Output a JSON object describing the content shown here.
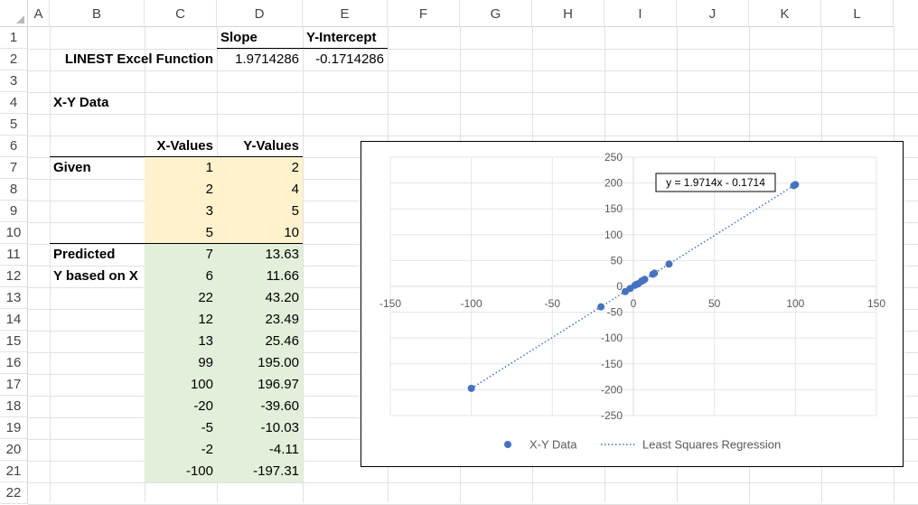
{
  "columns": [
    "A",
    "B",
    "C",
    "D",
    "E",
    "F",
    "G",
    "H",
    "I",
    "J",
    "K",
    "L"
  ],
  "rows": [
    "1",
    "2",
    "3",
    "4",
    "5",
    "6",
    "7",
    "8",
    "9",
    "10",
    "11",
    "12",
    "13",
    "14",
    "15",
    "16",
    "17",
    "18",
    "19",
    "20",
    "21",
    "22"
  ],
  "header": {
    "slope_label": "Slope",
    "intercept_label": "Y-Intercept"
  },
  "linest": {
    "label": "LINEST Excel Function",
    "slope": "1.9714286",
    "intercept": "-0.1714286"
  },
  "xy_title": "X-Y Data",
  "table": {
    "x_header": "X-Values",
    "y_header": "Y-Values",
    "given_label": "Given",
    "predicted_label": "Predicted",
    "predicted_sub": "Y based on X",
    "given": [
      {
        "x": "1",
        "y": "2"
      },
      {
        "x": "2",
        "y": "4"
      },
      {
        "x": "3",
        "y": "5"
      },
      {
        "x": "5",
        "y": "10"
      }
    ],
    "predicted": [
      {
        "x": "7",
        "y": "13.63"
      },
      {
        "x": "6",
        "y": "11.66"
      },
      {
        "x": "22",
        "y": "43.20"
      },
      {
        "x": "12",
        "y": "23.49"
      },
      {
        "x": "13",
        "y": "25.46"
      },
      {
        "x": "99",
        "y": "195.00"
      },
      {
        "x": "100",
        "y": "196.97"
      },
      {
        "x": "-20",
        "y": "-39.60"
      },
      {
        "x": "-5",
        "y": "-10.03"
      },
      {
        "x": "-2",
        "y": "-4.11"
      },
      {
        "x": "-100",
        "y": "-197.31"
      }
    ]
  },
  "chart_data": {
    "type": "scatter",
    "title": "",
    "xlabel": "",
    "ylabel": "",
    "xlim": [
      -150,
      150
    ],
    "ylim": [
      -250,
      250
    ],
    "x_ticks": [
      "-150",
      "-100",
      "-50",
      "0",
      "50",
      "100",
      "150"
    ],
    "y_ticks": [
      "250",
      "200",
      "150",
      "100",
      "50",
      "0",
      "-50",
      "-100",
      "-150",
      "-200",
      "-250"
    ],
    "grid": true,
    "legend_position": "bottom",
    "series": [
      {
        "name": "X-Y Data",
        "color": "#4472c4",
        "x": [
          1,
          2,
          3,
          5,
          7,
          6,
          22,
          12,
          13,
          99,
          100,
          -20,
          -5,
          -2,
          -100
        ],
        "y": [
          2,
          4,
          5,
          10,
          13.63,
          11.66,
          43.2,
          23.49,
          25.46,
          195.0,
          196.97,
          -39.6,
          -10.03,
          -4.11,
          -197.31
        ]
      }
    ],
    "trendline": {
      "name": "Least Squares Regression",
      "slope": 1.9714286,
      "intercept": -0.1714286,
      "x_range": [
        -100,
        100
      ],
      "equation": "y = 1.9714x - 0.1714",
      "color": "#4472c4"
    }
  }
}
